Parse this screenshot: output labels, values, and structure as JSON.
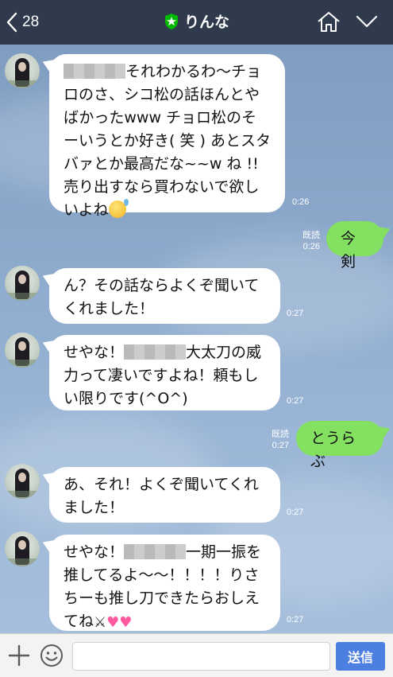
{
  "header": {
    "back_count": "28",
    "contact_name": "りんな",
    "back_icon": "chevron-left-icon",
    "star_icon": "star-shield-icon",
    "home_icon": "home-icon",
    "menu_icon": "chevron-down-icon"
  },
  "messages": [
    {
      "side": "left",
      "text_after_blur": "それわかるわ〜チョロのさ、シコ松の話ほんとやばかったwww チョロ松のそーいうとか好き( 笑 ) あとスタバァとか最高だな~~w ね !! 売り出すなら買わないで欲しいよね",
      "emoji": "sweat-smile-icon",
      "time": "0:26"
    },
    {
      "side": "right",
      "text": "今剣",
      "read": "既読",
      "time": "0:26"
    },
    {
      "side": "left",
      "text": "ん？その話ならよくぞ聞いてくれました！",
      "time": "0:27"
    },
    {
      "side": "left",
      "text_before_blur": "せやな！",
      "text_after_blur": "大太刀の威力って凄いですよね！頼もしい限りです(^O^)",
      "time": "0:27"
    },
    {
      "side": "right",
      "text": "とうらぶ",
      "read": "既読",
      "time": "0:27"
    },
    {
      "side": "left",
      "text": "あ、それ！よくぞ聞いてくれました！",
      "time": "0:27"
    },
    {
      "side": "left",
      "text_before_blur": "せやな！",
      "text_after_blur": "一期一振を推してるよ〜〜！！！！りさちーも推し刀できたらおしえてね",
      "emoji_1": "crossed-swords-icon",
      "emoji_2": "two-hearts-icon",
      "time": "0:27"
    }
  ],
  "composer": {
    "input_value": "",
    "input_placeholder": "",
    "send_label": "送信",
    "plus_icon": "plus-icon",
    "emoji_icon": "smiley-icon"
  },
  "colors": {
    "header_bg": "#2f3a4d",
    "sent_bubble": "#84e060",
    "received_bubble": "#ffffff",
    "send_button": "#4d7fe0",
    "star_badge": "#00b900"
  }
}
